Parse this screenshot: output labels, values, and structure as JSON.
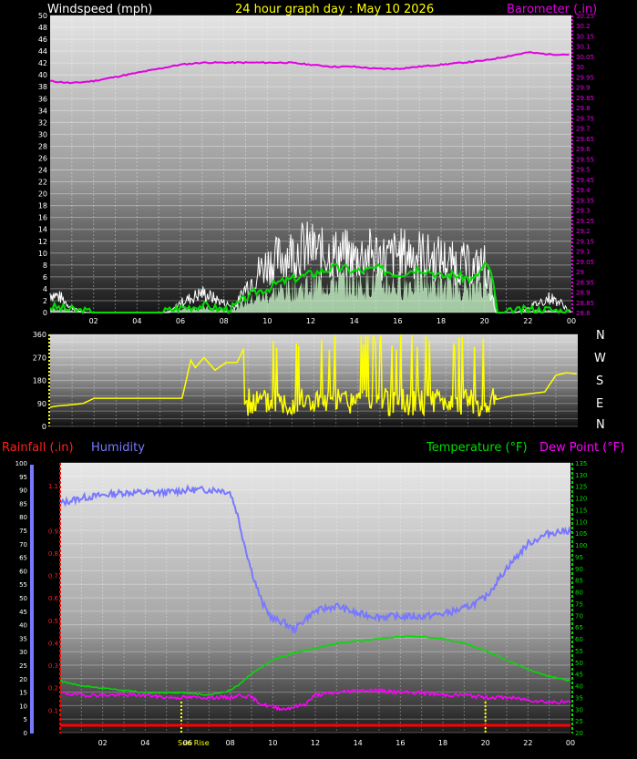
{
  "header": {
    "wind_title": "Windspeed (mph)",
    "date_title": "24 hour graph day : May 10 2026",
    "baro_title": "Barometer (.in)",
    "rain_title": "Rainfall (.in)",
    "humidity_title": "Humidity",
    "temp_title": "Temperature (°F)",
    "dew_title": "Dew Point (°F)"
  },
  "compass": [
    "N",
    "W",
    "S",
    "E",
    "N"
  ],
  "sunrise_label": "Sun Rise",
  "colors": {
    "wind_gust": "#ffffff",
    "wind_avg": "#00dd00",
    "wind_fill": "#c8f5c8",
    "barometer": "#e000e0",
    "direction": "#ffff00",
    "humidity": "#7878ff",
    "temperature": "#00dd00",
    "dewpoint": "#ff00ff",
    "rainfall": "#ff0000",
    "marker": "#ffff00",
    "date_title": "#ffff00",
    "rain_title": "#ff2020"
  },
  "chart_data": [
    {
      "type": "line",
      "title": "24 hour graph day : May 10 2026",
      "xlabel": "",
      "x_ticks": [
        "02",
        "04",
        "06",
        "08",
        "10",
        "12",
        "14",
        "16",
        "18",
        "20",
        "22",
        "00"
      ],
      "ylabel": "Windspeed (mph)",
      "ylim": [
        0,
        50
      ],
      "y_ticks": [
        0,
        2,
        4,
        6,
        8,
        10,
        12,
        14,
        16,
        18,
        20,
        22,
        24,
        26,
        28,
        30,
        32,
        34,
        36,
        38,
        40,
        42,
        44,
        46,
        48,
        50
      ],
      "y2label": "Barometer (.in)",
      "y2lim": [
        28.8,
        30.25
      ],
      "y2_ticks": [
        "28.8",
        "28.85",
        "28.9",
        "28.95",
        "29",
        "29.05",
        "29.1",
        "29.15",
        "29.2",
        "29.25",
        "29.3",
        "29.35",
        "29.4",
        "29.45",
        "29.5",
        "29.55",
        "29.6",
        "29.65",
        "29.7",
        "29.75",
        "29.8",
        "29.85",
        "29.9",
        "29.95",
        "30",
        "30.05",
        "30.1",
        "30.15",
        "30.2",
        "30.25"
      ],
      "series": [
        {
          "name": "Windspeed (mph)",
          "role": "gust",
          "x": [
            0,
            0.5,
            1,
            1.5,
            2,
            2.5,
            3,
            3.5,
            4,
            4.5,
            5,
            5.5,
            6,
            6.5,
            7,
            7.5,
            8,
            8.5,
            9,
            9.5,
            10,
            10.5,
            11,
            11.5,
            12,
            12.5,
            13,
            13.5,
            14,
            14.5,
            15,
            15.5,
            16,
            16.5,
            17,
            17.5,
            18,
            18.5,
            19,
            19.5,
            20,
            20.5,
            21,
            21.5,
            22,
            22.5,
            23,
            23.5,
            24
          ],
          "values": [
            4,
            3,
            1,
            0,
            0,
            0,
            0,
            0,
            0,
            0,
            0,
            0,
            2,
            3,
            4,
            3,
            2,
            1,
            5,
            8,
            10,
            11,
            12,
            13,
            13,
            12,
            12,
            12,
            11,
            12,
            12,
            11,
            12,
            12,
            12,
            11,
            11,
            10,
            10,
            9,
            10,
            0,
            0,
            0,
            1,
            2,
            3,
            2,
            0
          ]
        },
        {
          "name": "Windspeed avg",
          "role": "average",
          "x": [
            0,
            1,
            2,
            3,
            4,
            5,
            6,
            7,
            8,
            8.5,
            9,
            9.5,
            10,
            10.5,
            11,
            11.5,
            12,
            12.5,
            13,
            13.5,
            14,
            14.5,
            15,
            15.5,
            16,
            16.5,
            17,
            17.5,
            18,
            18.5,
            19,
            19.5,
            20,
            20.3,
            20.6,
            21,
            22,
            23,
            24
          ],
          "values": [
            1,
            0.5,
            0,
            0,
            0,
            0,
            0.8,
            1.2,
            0.5,
            1,
            2.5,
            3.5,
            4,
            5,
            5.5,
            6,
            6.5,
            7,
            7.5,
            7.5,
            7,
            7,
            7.5,
            7,
            6.5,
            7,
            7.5,
            7,
            6,
            6.5,
            6,
            5.5,
            8,
            7,
            0,
            0,
            0.5,
            0.5,
            0
          ]
        },
        {
          "name": "Barometer (.in)",
          "axis": "y2",
          "x": [
            0,
            1,
            2,
            3,
            4,
            5,
            6,
            7,
            8,
            9,
            10,
            11,
            12,
            13,
            14,
            15,
            16,
            17,
            18,
            19,
            20,
            21,
            22,
            23,
            24
          ],
          "values": [
            29.93,
            29.92,
            29.93,
            29.95,
            29.97,
            29.99,
            30.01,
            30.02,
            30.02,
            30.02,
            30.02,
            30.02,
            30.01,
            30.0,
            30.0,
            29.99,
            29.99,
            30.0,
            30.01,
            30.02,
            30.03,
            30.05,
            30.07,
            30.06,
            30.06
          ]
        }
      ]
    },
    {
      "type": "line",
      "title": "",
      "ylabel": "",
      "ylim": [
        0,
        360
      ],
      "y_ticks": [
        0,
        90,
        180,
        270,
        360
      ],
      "series": [
        {
          "name": "Wind direction (deg)",
          "x": [
            0,
            0.3,
            1,
            1.5,
            2,
            3,
            4,
            5,
            6,
            6.4,
            6.6,
            7,
            7.5,
            8,
            8.5,
            9,
            9.5,
            10,
            10.5,
            11,
            11.5,
            12,
            12.5,
            13,
            13.5,
            14,
            14.5,
            15,
            15.5,
            16,
            16.5,
            17,
            17.5,
            18,
            18.5,
            19,
            19.5,
            20,
            20.5,
            21,
            21.5,
            22,
            22.5,
            23,
            23.5,
            24
          ],
          "values": [
            75,
            80,
            85,
            90,
            110,
            110,
            110,
            110,
            110,
            260,
            230,
            270,
            220,
            250,
            250,
            340,
            60,
            260,
            30,
            310,
            70,
            200,
            80,
            320,
            60,
            300,
            90,
            200,
            60,
            330,
            80,
            70,
            240,
            80,
            330,
            60,
            110,
            100,
            110,
            120,
            125,
            130,
            135,
            200,
            210,
            205
          ]
        }
      ]
    },
    {
      "type": "line",
      "title": "",
      "x_ticks": [
        "02",
        "04",
        "06",
        "08",
        "10",
        "12",
        "14",
        "16",
        "18",
        "20",
        "22",
        "00"
      ],
      "ylabel": "Humidity",
      "ylim": [
        0,
        100
      ],
      "y_ticks": [
        0,
        5,
        10,
        15,
        20,
        25,
        30,
        35,
        40,
        45,
        50,
        55,
        60,
        65,
        70,
        75,
        80,
        85,
        90,
        95,
        100
      ],
      "rain_axis": {
        "label": "Rainfall (.in)",
        "ticks": [
          "0.1",
          "0.2",
          "0.3",
          "0.4",
          "0.5",
          "0.6",
          "0.7",
          "0.8",
          "0.9",
          "1.1"
        ]
      },
      "y2label": "Temperature (°F)   Dew Point (°F)",
      "y2lim": [
        20,
        135
      ],
      "y2_ticks": [
        20,
        25,
        30,
        35,
        40,
        45,
        50,
        55,
        60,
        65,
        70,
        75,
        80,
        85,
        90,
        95,
        100,
        105,
        110,
        115,
        120,
        125,
        130,
        135
      ],
      "series": [
        {
          "name": "Humidity",
          "x": [
            0,
            1,
            2,
            3,
            4,
            5,
            6,
            7,
            7.5,
            8,
            8.3,
            8.6,
            9,
            9.5,
            10,
            10.5,
            11,
            11.5,
            12,
            13,
            14,
            15,
            16,
            17,
            18,
            19,
            20,
            21,
            22,
            23,
            24
          ],
          "values": [
            85,
            87,
            88,
            89,
            89,
            89,
            90,
            90,
            90,
            89,
            82,
            72,
            60,
            48,
            42,
            41,
            38,
            42,
            45,
            47,
            44,
            43,
            43,
            43,
            44,
            46,
            50,
            61,
            70,
            74,
            75
          ]
        },
        {
          "name": "Temperature (°F)",
          "x": [
            0,
            1,
            2,
            3,
            4,
            5,
            6,
            7,
            8,
            8.5,
            9,
            9.5,
            10,
            11,
            12,
            13,
            14,
            15,
            16,
            17,
            18,
            19,
            20,
            21,
            22,
            23,
            24
          ],
          "values": [
            42,
            40,
            39,
            38,
            37,
            37,
            37,
            36,
            38,
            41,
            45,
            48,
            51,
            54,
            56,
            58,
            59,
            60,
            61,
            61,
            60,
            58,
            55,
            51,
            47,
            44,
            42
          ]
        },
        {
          "name": "Dew Point (°F)",
          "x": [
            0,
            1,
            2,
            3,
            4,
            5,
            6,
            7,
            8,
            8.5,
            9,
            9.5,
            10,
            10.5,
            11,
            11.5,
            12,
            13,
            14,
            15,
            16,
            17,
            18,
            19,
            20,
            21,
            22,
            23,
            24
          ],
          "values": [
            37,
            36,
            36,
            36,
            36,
            35,
            35,
            35,
            35,
            36,
            35,
            32,
            31,
            30,
            31,
            32,
            36,
            37,
            38,
            38,
            37,
            37,
            36,
            36,
            35,
            35,
            34,
            33,
            33
          ]
        },
        {
          "name": "Rainfall (.in)",
          "axis": "rain",
          "x": [
            0,
            24
          ],
          "values": [
            0,
            0
          ]
        }
      ]
    }
  ]
}
